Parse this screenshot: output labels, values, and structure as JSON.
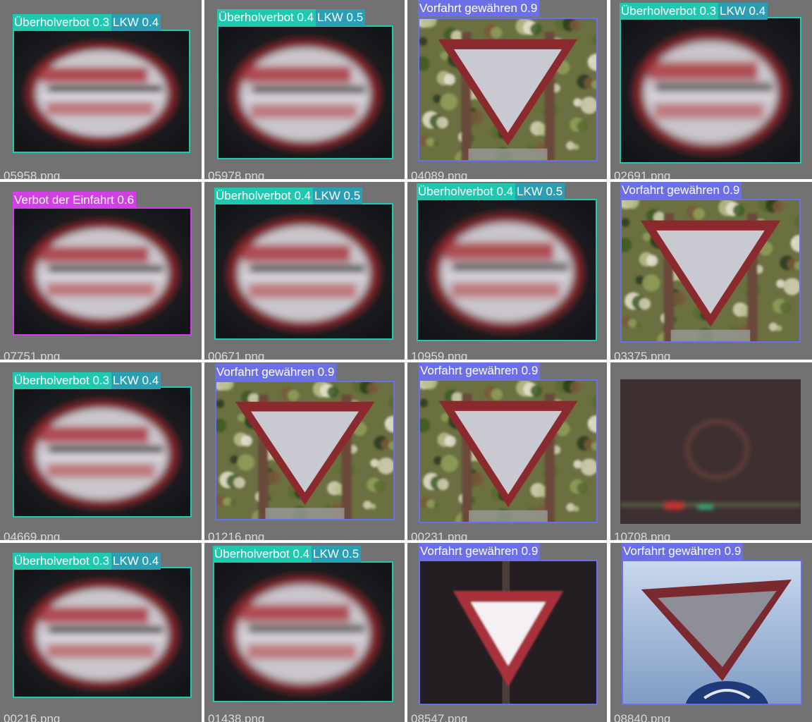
{
  "colors": {
    "background": "#727272",
    "separator": "#ffffff",
    "filename_text": "#d8d8d8"
  },
  "classes": {
    "ueberholverbot": {
      "name": "Überholverbot",
      "color": "#1fc9b0"
    },
    "lkw": {
      "name": "LKW",
      "color": "#2a9fb4"
    },
    "vorfahrt": {
      "name": "Vorfahrt gewähren",
      "color": "#6b6fe8"
    },
    "verbot_einfahrt": {
      "name": "Verbot der Einfahrt",
      "color": "#d43ee8"
    }
  },
  "tiles": [
    {
      "filename": "05958.png",
      "scene": "round-blur",
      "detections": [
        {
          "class": "ueberholverbot",
          "label": "Überholverbot 0.3"
        },
        {
          "class": "lkw",
          "label": "LKW 0.4"
        }
      ]
    },
    {
      "filename": "05978.png",
      "scene": "round-blur",
      "detections": [
        {
          "class": "ueberholverbot",
          "label": "Überholverbot 0.4"
        },
        {
          "class": "lkw",
          "label": "LKW 0.5"
        }
      ]
    },
    {
      "filename": "04089.png",
      "scene": "yield-foliage",
      "detections": [
        {
          "class": "vorfahrt",
          "label": "Vorfahrt gewähren 0.9"
        }
      ]
    },
    {
      "filename": "02691.png",
      "scene": "round-blur",
      "detections": [
        {
          "class": "ueberholverbot",
          "label": "Überholverbot 0.3"
        },
        {
          "class": "lkw",
          "label": "LKW 0.4"
        }
      ]
    },
    {
      "filename": "07751.png",
      "scene": "round-blur",
      "detections": [
        {
          "class": "verbot_einfahrt",
          "label": "Verbot der Einfahrt 0.6"
        }
      ]
    },
    {
      "filename": "00671.png",
      "scene": "round-blur",
      "detections": [
        {
          "class": "ueberholverbot",
          "label": "Überholverbot 0.4"
        },
        {
          "class": "lkw",
          "label": "LKW 0.5"
        }
      ]
    },
    {
      "filename": "10959.png",
      "scene": "round-blur",
      "detections": [
        {
          "class": "ueberholverbot",
          "label": "Überholverbot 0.4"
        },
        {
          "class": "lkw",
          "label": "LKW 0.5"
        }
      ]
    },
    {
      "filename": "03375.png",
      "scene": "yield-foliage",
      "detections": [
        {
          "class": "vorfahrt",
          "label": "Vorfahrt gewähren 0.9"
        }
      ]
    },
    {
      "filename": "04669.png",
      "scene": "round-blur",
      "detections": [
        {
          "class": "ueberholverbot",
          "label": "Überholverbot 0.3"
        },
        {
          "class": "lkw",
          "label": "LKW 0.4"
        }
      ]
    },
    {
      "filename": "01216.png",
      "scene": "yield-foliage",
      "detections": [
        {
          "class": "vorfahrt",
          "label": "Vorfahrt gewähren 0.9"
        }
      ]
    },
    {
      "filename": "00231.png",
      "scene": "yield-foliage",
      "detections": [
        {
          "class": "vorfahrt",
          "label": "Vorfahrt gewähren 0.9"
        }
      ]
    },
    {
      "filename": "10708.png",
      "scene": "dark-scene",
      "detections": []
    },
    {
      "filename": "00216.png",
      "scene": "round-blur",
      "detections": [
        {
          "class": "ueberholverbot",
          "label": "Überholverbot 0.3"
        },
        {
          "class": "lkw",
          "label": "LKW 0.4"
        }
      ]
    },
    {
      "filename": "01438.png",
      "scene": "round-blur",
      "detections": [
        {
          "class": "ueberholverbot",
          "label": "Überholverbot 0.4"
        },
        {
          "class": "lkw",
          "label": "LKW 0.5"
        }
      ]
    },
    {
      "filename": "08547.png",
      "scene": "yield-dark",
      "detections": [
        {
          "class": "vorfahrt",
          "label": "Vorfahrt gewähren 0.9"
        }
      ]
    },
    {
      "filename": "08840.png",
      "scene": "yield-sky",
      "detections": [
        {
          "class": "vorfahrt",
          "label": "Vorfahrt gewähren 0.9"
        }
      ]
    }
  ]
}
